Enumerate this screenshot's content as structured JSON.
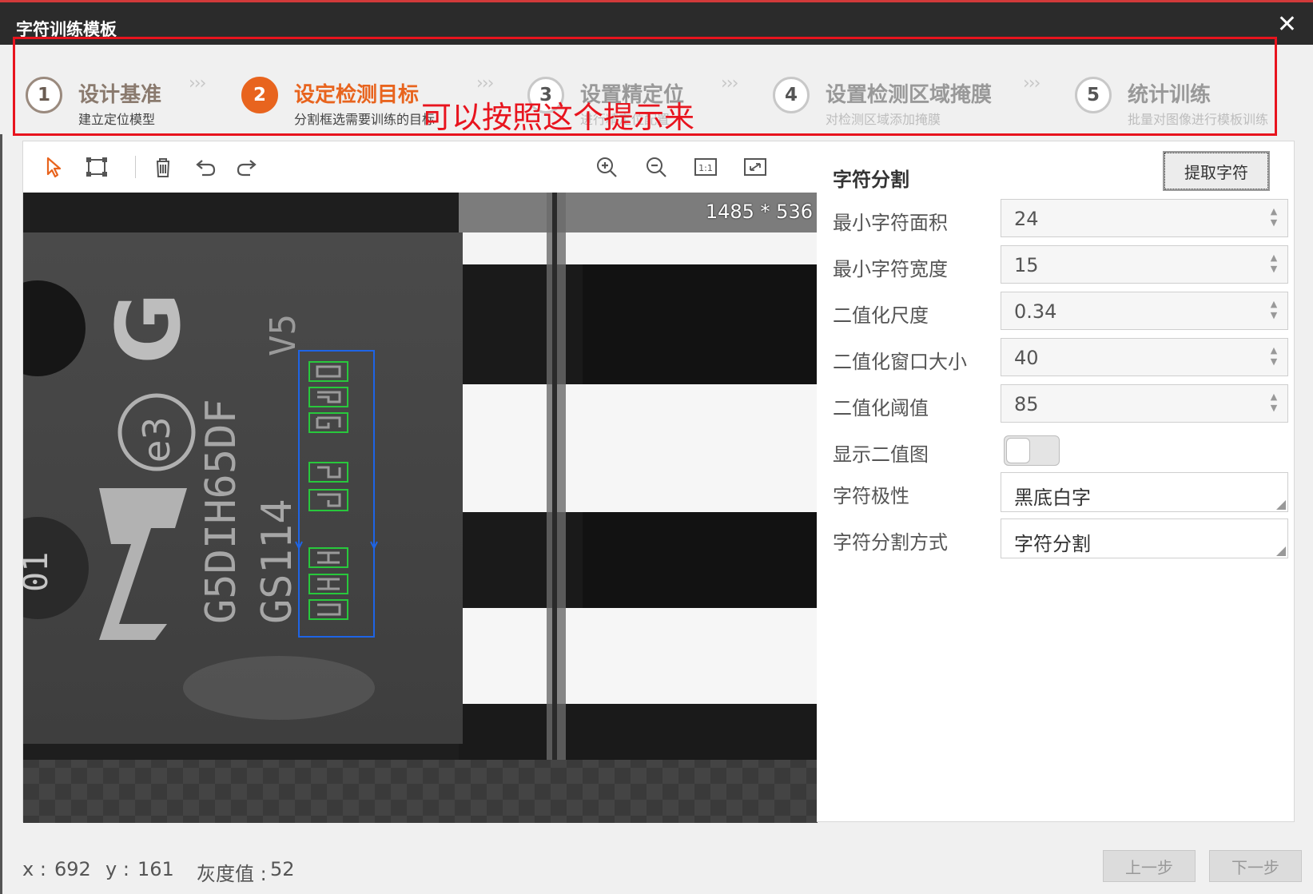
{
  "window": {
    "title": "字符训练模板",
    "close_glyph": "✕"
  },
  "steps": [
    {
      "num": "1",
      "name": "设计基准",
      "desc": "建立定位模型",
      "state": "done"
    },
    {
      "num": "2",
      "name": "设定检测目标",
      "desc": "分割框选需要训练的目标",
      "state": "active"
    },
    {
      "num": "3",
      "name": "设置精定位",
      "desc": "进行精定位配置",
      "state": "pending"
    },
    {
      "num": "4",
      "name": "设置检测区域掩膜",
      "desc": "对检测区域添加掩膜",
      "state": "pending"
    },
    {
      "num": "5",
      "name": "统计训练",
      "desc": "批量对图像进行模板训练",
      "state": "pending"
    }
  ],
  "step_separator": "›››",
  "annotation": "可以按照这个提示来",
  "toolbar": {
    "tools": [
      "select-arrow-icon",
      "rect-roi-icon",
      "delete-trash-icon",
      "undo-icon",
      "redo-icon",
      "zoom-in-icon",
      "zoom-out-icon",
      "actual-size-icon",
      "fit-window-icon"
    ]
  },
  "image": {
    "size_label": "1485 * 536",
    "chip_text_lines": [
      "G5DIH65DF",
      "GS114"
    ],
    "chip_logo": "G",
    "chip_mark": "e3",
    "chip_v": "V5",
    "side_text": "01"
  },
  "panel": {
    "title": "字符分割",
    "extract_button": "提取字符",
    "fields": [
      {
        "label": "最小字符面积",
        "value": "24"
      },
      {
        "label": "最小字符宽度",
        "value": "15"
      },
      {
        "label": "二值化尺度",
        "value": "0.34"
      },
      {
        "label": "二值化窗口大小",
        "value": "40"
      },
      {
        "label": "二值化阈值",
        "value": "85"
      }
    ],
    "toggle": {
      "label": "显示二值图",
      "on": false
    },
    "selects": [
      {
        "label": "字符极性",
        "value": "黑底白字"
      },
      {
        "label": "字符分割方式",
        "value": "字符分割"
      }
    ]
  },
  "status": {
    "x_label": "x :",
    "x_value": "692",
    "y_label": "y :",
    "y_value": "161",
    "gray_label": "灰度值 :",
    "gray_value": "52"
  },
  "nav": {
    "prev": "上一步",
    "next": "下一步"
  },
  "colors": {
    "accent": "#e8641e",
    "annotation_red": "#e8141e",
    "roi_blue": "#1e64e6",
    "char_green": "#28c83c"
  }
}
